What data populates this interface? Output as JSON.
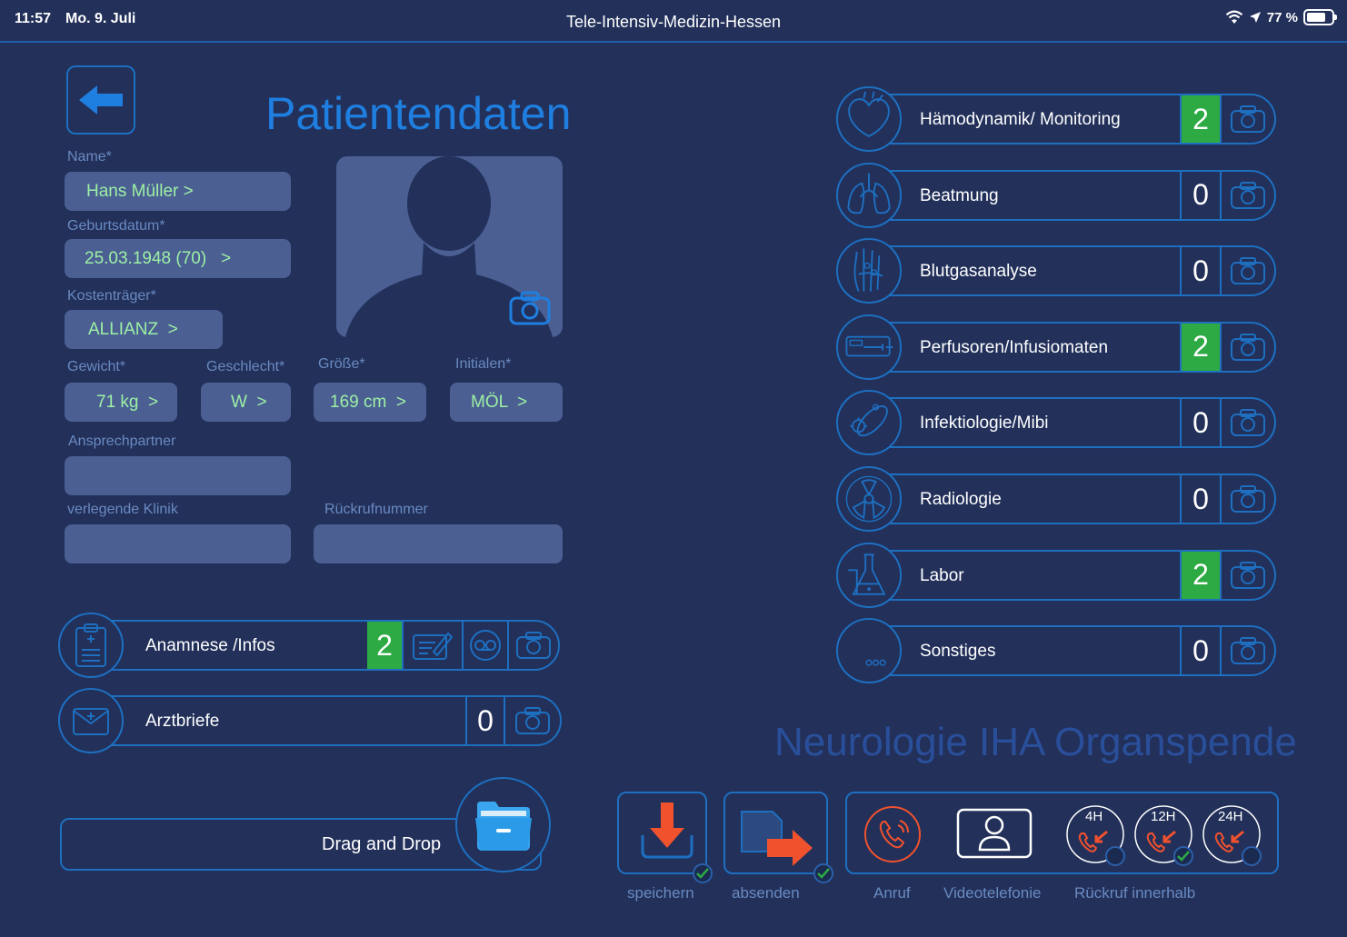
{
  "status_bar": {
    "time": "11:57",
    "date": "Mo. 9. Juli",
    "title": "Tele-Intensiv-Medizin-Hessen",
    "battery": "77 %"
  },
  "page_title": "Patientendaten",
  "fields": {
    "name": {
      "label": "Name*",
      "value": "Hans Müller >"
    },
    "birth": {
      "label": "Geburtsdatum*",
      "value": "25.03.1948 (70)   >"
    },
    "insurer": {
      "label": "Kostenträger*",
      "value": "ALLIANZ  >"
    },
    "weight": {
      "label": "Gewicht*",
      "value": "71 kg  >"
    },
    "sex": {
      "label": "Geschlecht*",
      "value": "W  >"
    },
    "height": {
      "label": "Größe*",
      "value": "169 cm  >"
    },
    "initials": {
      "label": "Initialen*",
      "value": "MÖL  >"
    },
    "contact": {
      "label": "Ansprechpartner",
      "value": ""
    },
    "clinic": {
      "label": "verlegende Klinik",
      "value": ""
    },
    "callback": {
      "label": "Rückrufnummer",
      "value": ""
    }
  },
  "left_pills": {
    "anamnese": {
      "label": "Anamnese /Infos",
      "count": "2"
    },
    "arztbriefe": {
      "label": "Arztbriefe",
      "count": "0"
    }
  },
  "categories": [
    {
      "label": "Hämodynamik/ Monitoring",
      "count": "2",
      "icon": "heart-icon"
    },
    {
      "label": "Beatmung",
      "count": "0",
      "icon": "lungs-icon"
    },
    {
      "label": "Blutgasanalyse",
      "count": "0",
      "icon": "hand-icon"
    },
    {
      "label": "Perfusoren/Infusiomaten",
      "count": "2",
      "icon": "infusion-pump-icon"
    },
    {
      "label": "Infektiologie/Mibi",
      "count": "0",
      "icon": "bacteria-icon"
    },
    {
      "label": "Radiologie",
      "count": "0",
      "icon": "radiation-icon"
    },
    {
      "label": "Labor",
      "count": "2",
      "icon": "flask-icon"
    },
    {
      "label": "Sonstiges",
      "count": "0",
      "icon": "more-icon"
    }
  ],
  "neuro_text": "Neurologie IHA Organspende",
  "drag_drop": "Drag and Drop",
  "bottom": {
    "save": "speichern",
    "send": "absenden",
    "call": "Anruf",
    "video": "Videotelefonie",
    "callback": "Rückruf innerhalb",
    "cb4": "4H",
    "cb12": "12H",
    "cb24": "24H"
  },
  "colors": {
    "background": "#22305a",
    "accent": "#1e6fc0",
    "green": "#2eaa44",
    "field": "#4b5f93",
    "field_text": "#9cf0a4",
    "orange": "#f0522e"
  }
}
